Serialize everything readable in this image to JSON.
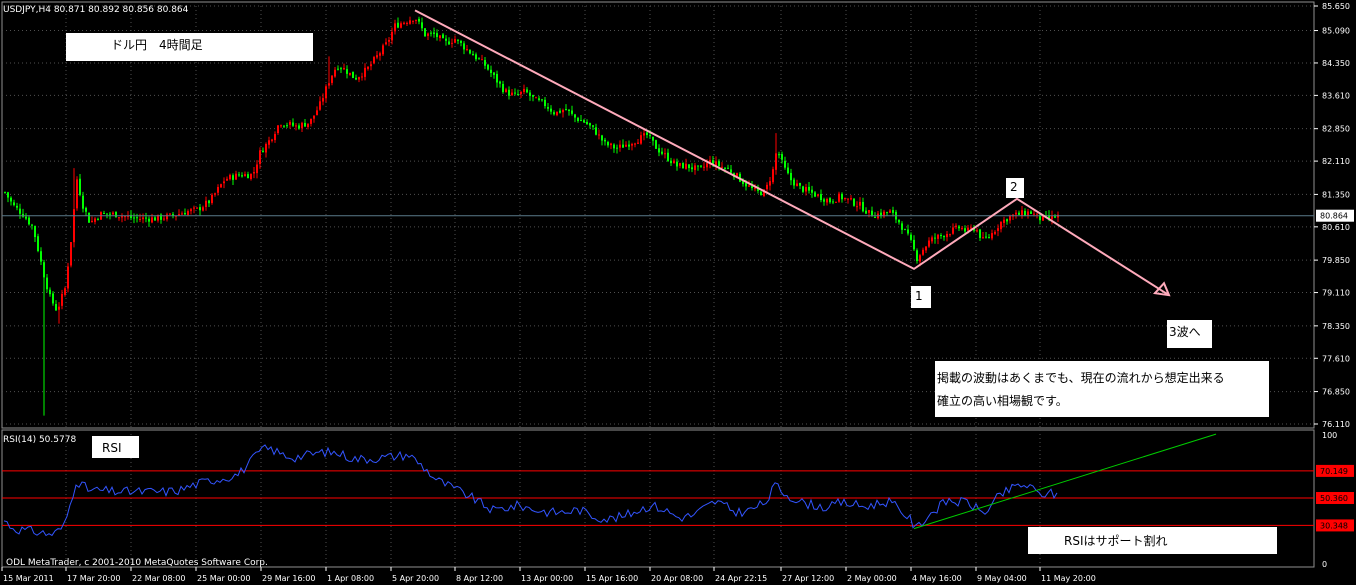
{
  "main_chart": {
    "header": "USDJPY,H4  80.871 80.892 80.856 80.864",
    "current_price_label": "80.864",
    "current_price": 80.864,
    "price_range": [
      76.11,
      85.65
    ],
    "price_ticks": [
      "85.650",
      "85.090",
      "84.350",
      "83.610",
      "82.850",
      "82.110",
      "81.350",
      "80.610",
      "79.850",
      "79.110",
      "78.350",
      "77.610",
      "76.850",
      "76.110"
    ]
  },
  "rsi_panel": {
    "header": "RSI(14) 50.5778",
    "ticks": [
      "100",
      "70.149",
      "50.360",
      "30.348",
      "0"
    ],
    "levels": [
      70.149,
      50.36,
      30.348
    ],
    "copyright": "ODL MetaTrader, c 2001-2010 MetaQuotes Software Corp."
  },
  "time_axis": [
    "15 Mar 2011",
    "17 Mar 20:00",
    "22 Mar 08:00",
    "25 Mar 00:00",
    "29 Mar 16:00",
    "1 Apr 08:00",
    "5 Apr 20:00",
    "8 Apr 12:00",
    "13 Apr 00:00",
    "15 Apr 16:00",
    "20 Apr 08:00",
    "24 Apr 22:15",
    "27 Apr 12:00",
    "2 May 00:00",
    "4 May 16:00",
    "9 May 04:00",
    "11 May 20:00"
  ],
  "annotations": {
    "title": "ドル円　4時間足",
    "rsi_label": "RSI",
    "wave1": "1",
    "wave2": "2",
    "wave3": "3波へ",
    "disclaimer_line1": "掲載の波動はあくまでも、現在の流れから想定出来る",
    "disclaimer_line2": "確立の高い相場観です。",
    "rsi_note": "RSIはサポート割れ"
  },
  "colors": {
    "background": "#000000",
    "bull": "#ff0000",
    "bear": "#00ff00",
    "grid": "#505050",
    "axis_text": "#ffffff",
    "rsi_line": "#3355ff",
    "rsi_levels": "#ff0000",
    "trend_pink": "#ffaabb",
    "trend_green": "#00cc00",
    "price_line": "#5a7a8a"
  },
  "chart_data": [
    {
      "type": "candlestick",
      "symbol": "USDJPY",
      "timeframe": "H4",
      "ylim": [
        76.11,
        85.65
      ],
      "last": {
        "open": 80.871,
        "high": 80.892,
        "low": 80.856,
        "close": 80.864
      },
      "path": [
        [
          0,
          81.4
        ],
        [
          8,
          81.1
        ],
        [
          18,
          80.9
        ],
        [
          28,
          80.6
        ],
        [
          38,
          79.6
        ],
        [
          45,
          79.0
        ],
        [
          52,
          78.7
        ],
        [
          60,
          79.2
        ],
        [
          66,
          80.3
        ],
        [
          72,
          81.7
        ],
        [
          78,
          81.1
        ],
        [
          85,
          80.7
        ],
        [
          95,
          80.9
        ],
        [
          110,
          80.9
        ],
        [
          130,
          80.8
        ],
        [
          150,
          80.8
        ],
        [
          165,
          80.85
        ],
        [
          180,
          80.95
        ],
        [
          192,
          81.0
        ],
        [
          205,
          81.2
        ],
        [
          220,
          81.7
        ],
        [
          235,
          81.8
        ],
        [
          248,
          81.8
        ],
        [
          255,
          82.3
        ],
        [
          265,
          82.6
        ],
        [
          275,
          83.0
        ],
        [
          292,
          82.9
        ],
        [
          305,
          83.0
        ],
        [
          315,
          83.4
        ],
        [
          325,
          84.0
        ],
        [
          332,
          84.3
        ],
        [
          340,
          84.2
        ],
        [
          350,
          84.0
        ],
        [
          362,
          84.2
        ],
        [
          372,
          84.5
        ],
        [
          382,
          84.8
        ],
        [
          390,
          85.2
        ],
        [
          400,
          85.3
        ],
        [
          410,
          85.4
        ],
        [
          420,
          85.0
        ],
        [
          430,
          85.0
        ],
        [
          440,
          84.8
        ],
        [
          450,
          84.9
        ],
        [
          460,
          84.7
        ],
        [
          470,
          84.5
        ],
        [
          480,
          84.3
        ],
        [
          490,
          84.0
        ],
        [
          500,
          83.7
        ],
        [
          510,
          83.6
        ],
        [
          520,
          83.7
        ],
        [
          530,
          83.5
        ],
        [
          540,
          83.4
        ],
        [
          550,
          83.2
        ],
        [
          560,
          83.3
        ],
        [
          570,
          83.1
        ],
        [
          580,
          83.0
        ],
        [
          590,
          82.8
        ],
        [
          600,
          82.5
        ],
        [
          612,
          82.4
        ],
        [
          622,
          82.5
        ],
        [
          632,
          82.6
        ],
        [
          642,
          82.7
        ],
        [
          652,
          82.4
        ],
        [
          662,
          82.2
        ],
        [
          672,
          82.0
        ],
        [
          682,
          82.0
        ],
        [
          695,
          81.9
        ],
        [
          705,
          82.1
        ],
        [
          715,
          82.0
        ],
        [
          725,
          81.9
        ],
        [
          735,
          81.7
        ],
        [
          745,
          81.5
        ],
        [
          752,
          81.4
        ],
        [
          760,
          81.4
        ],
        [
          768,
          81.9
        ],
        [
          772,
          82.4
        ],
        [
          778,
          82.0
        ],
        [
          785,
          81.7
        ],
        [
          795,
          81.5
        ],
        [
          805,
          81.4
        ],
        [
          815,
          81.3
        ],
        [
          825,
          81.2
        ],
        [
          835,
          81.3
        ],
        [
          845,
          81.2
        ],
        [
          855,
          81.1
        ],
        [
          865,
          80.9
        ],
        [
          875,
          80.9
        ],
        [
          885,
          80.95
        ],
        [
          895,
          80.7
        ],
        [
          905,
          80.3
        ],
        [
          912,
          79.9
        ],
        [
          918,
          80.1
        ],
        [
          925,
          80.3
        ],
        [
          935,
          80.4
        ],
        [
          945,
          80.5
        ],
        [
          955,
          80.6
        ],
        [
          962,
          80.5
        ],
        [
          970,
          80.6
        ],
        [
          978,
          80.3
        ],
        [
          985,
          80.4
        ],
        [
          995,
          80.7
        ],
        [
          1005,
          80.85
        ],
        [
          1015,
          80.9
        ],
        [
          1025,
          80.95
        ],
        [
          1035,
          80.8
        ],
        [
          1045,
          80.8
        ],
        [
          1055,
          80.87
        ]
      ]
    },
    {
      "type": "line",
      "name": "RSI(14)",
      "ylim": [
        0,
        100
      ],
      "levels": [
        70.149,
        50.36,
        30.348
      ],
      "path": [
        [
          0,
          34
        ],
        [
          10,
          28
        ],
        [
          20,
          27
        ],
        [
          30,
          26
        ],
        [
          38,
          25
        ],
        [
          45,
          24
        ],
        [
          52,
          25
        ],
        [
          60,
          30
        ],
        [
          66,
          45
        ],
        [
          72,
          63
        ],
        [
          78,
          60
        ],
        [
          85,
          56
        ],
        [
          95,
          56
        ],
        [
          110,
          55
        ],
        [
          125,
          55
        ],
        [
          140,
          55
        ],
        [
          160,
          55
        ],
        [
          175,
          56
        ],
        [
          190,
          60
        ],
        [
          205,
          63
        ],
        [
          220,
          65
        ],
        [
          235,
          68
        ],
        [
          248,
          78
        ],
        [
          258,
          86
        ],
        [
          268,
          86
        ],
        [
          278,
          82
        ],
        [
          290,
          80
        ],
        [
          305,
          82
        ],
        [
          320,
          84
        ],
        [
          335,
          83
        ],
        [
          350,
          79
        ],
        [
          365,
          79
        ],
        [
          380,
          80
        ],
        [
          392,
          81
        ],
        [
          405,
          82
        ],
        [
          418,
          74
        ],
        [
          432,
          64
        ],
        [
          448,
          58
        ],
        [
          465,
          52
        ],
        [
          480,
          45
        ],
        [
          490,
          41
        ],
        [
          500,
          43
        ],
        [
          515,
          45
        ],
        [
          530,
          42
        ],
        [
          545,
          40
        ],
        [
          560,
          40
        ],
        [
          575,
          42
        ],
        [
          590,
          37
        ],
        [
          605,
          35
        ],
        [
          620,
          37
        ],
        [
          635,
          42
        ],
        [
          648,
          45
        ],
        [
          660,
          42
        ],
        [
          675,
          36
        ],
        [
          690,
          38
        ],
        [
          700,
          43
        ],
        [
          712,
          48
        ],
        [
          722,
          44
        ],
        [
          732,
          40
        ],
        [
          745,
          41
        ],
        [
          752,
          44
        ],
        [
          760,
          46
        ],
        [
          766,
          52
        ],
        [
          771,
          60
        ],
        [
          778,
          55
        ],
        [
          785,
          52
        ],
        [
          798,
          47
        ],
        [
          812,
          45
        ],
        [
          825,
          43
        ],
        [
          835,
          47
        ],
        [
          848,
          46
        ],
        [
          860,
          44
        ],
        [
          872,
          46
        ],
        [
          885,
          48
        ],
        [
          895,
          42
        ],
        [
          905,
          36
        ],
        [
          912,
          28
        ],
        [
          918,
          33
        ],
        [
          925,
          38
        ],
        [
          935,
          44
        ],
        [
          945,
          49
        ],
        [
          955,
          47
        ],
        [
          962,
          48
        ],
        [
          970,
          44
        ],
        [
          978,
          40
        ],
        [
          985,
          42
        ],
        [
          995,
          52
        ],
        [
          1005,
          56
        ],
        [
          1015,
          60
        ],
        [
          1025,
          59
        ],
        [
          1035,
          53
        ],
        [
          1045,
          54
        ],
        [
          1055,
          52
        ]
      ]
    }
  ]
}
